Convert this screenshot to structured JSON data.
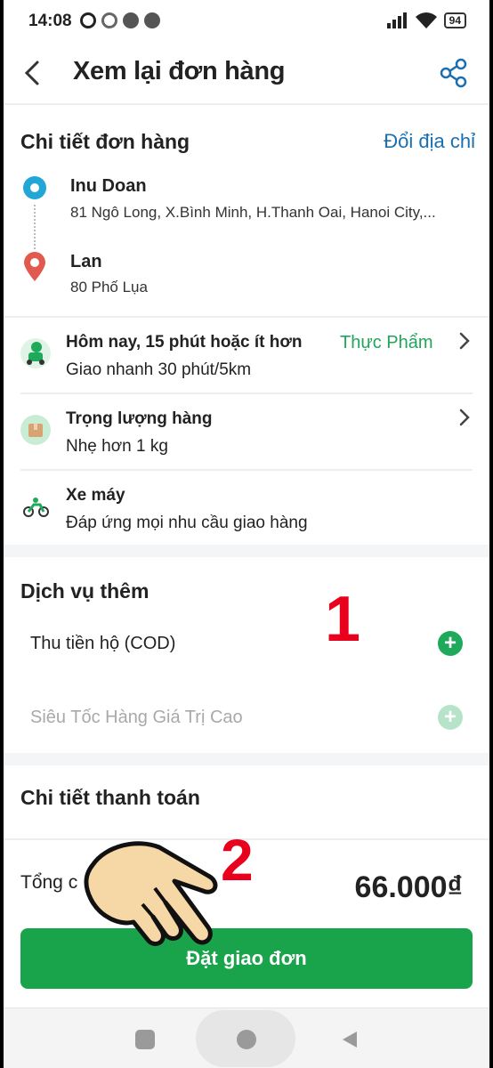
{
  "status_bar": {
    "time": "14:08",
    "battery": "94"
  },
  "header": {
    "title": "Xem lại đơn hàng"
  },
  "order_detail": {
    "title": "Chi tiết đơn hàng",
    "change_address": "Đổi địa chỉ",
    "pickup": {
      "name": "Inu Doan",
      "address": "81 Ngô Long, X.Bình Minh, H.Thanh Oai, Hanoi City,..."
    },
    "dropoff": {
      "name": "Lan",
      "address": "80 Phố Lụa"
    }
  },
  "service_rows": [
    {
      "title": "Hôm nay, 15 phút hoặc ít hơn",
      "tag": "Thực Phẩm",
      "sub": "Giao nhanh 30 phút/5km",
      "icon": "delivery-driver-icon"
    },
    {
      "title": "Trọng lượng hàng",
      "sub": "Nhẹ hơn 1 kg",
      "icon": "package-icon"
    },
    {
      "title": "Xe máy",
      "sub": "Đáp ứng mọi nhu cầu giao hàng",
      "icon": "motorbike-icon"
    }
  ],
  "extra_services": {
    "title": "Dịch vụ thêm",
    "items": [
      {
        "label": "Thu tiền hộ (COD)",
        "enabled": true
      },
      {
        "label": "Siêu Tốc Hàng Giá Trị Cao",
        "enabled": false
      }
    ]
  },
  "payment": {
    "title": "Chi tiết thanh toán",
    "total_label": "Tổng c",
    "total_value": "66.000₫",
    "cta": "Đặt giao đơn"
  },
  "annotations": {
    "step1": "1",
    "step2": "2"
  },
  "colors": {
    "accent_green": "#19a34a",
    "link_blue": "#1a6fb0",
    "annotation_red": "#e8001c"
  }
}
